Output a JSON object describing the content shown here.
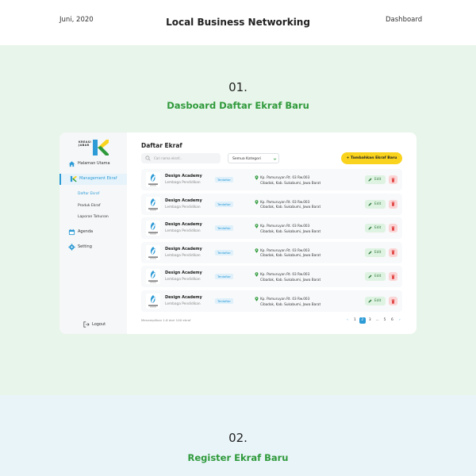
{
  "header": {
    "date": "Juni, 2020",
    "title": "Local Business Networking",
    "right_link": "Dashboard"
  },
  "section1": {
    "number": "01.",
    "title": "Dasboard Daftar Ekraf Baru"
  },
  "section2": {
    "number": "02.",
    "title": "Register Ekraf  Baru"
  },
  "colors": {
    "accent_blue": "#2d9bd6",
    "brand_green": "#2f9a3b",
    "button_yellow": "#f9d31e",
    "section1_bg": "#e8f5ea",
    "section2_bg": "#e9f4f9"
  },
  "logo": {
    "line1": "KREASI",
    "line2": "JABAR"
  },
  "sidebar": {
    "items": [
      {
        "label": "Halaman Utama",
        "icon": "home-icon"
      },
      {
        "label": "Management Ekraf",
        "icon": "k-logo-icon"
      },
      {
        "label": "Agenda",
        "icon": "calendar-icon"
      },
      {
        "label": "Setting",
        "icon": "gear-icon"
      }
    ],
    "subitems": [
      {
        "label": "Daftar Ekraf"
      },
      {
        "label": "Produk Ekraf"
      },
      {
        "label": "Laporan Tahunan"
      }
    ],
    "logout": "Logout"
  },
  "main": {
    "title": "Daftar Ekraf",
    "search_placeholder": "Cari nama ekraf...",
    "category_select": "Semua Kategori",
    "add_button": "+ Tambahkan Ekraf Baru",
    "rows": [
      {
        "name": "Design Academy",
        "type": "Lembaga Pendidikan",
        "status": "Terdaftar",
        "address1": "Kp. Pamuruyan Rt. 03 Rw.003",
        "address2": "Cibadak, Kab. Sukabumi, Jawa Barat",
        "edit": "Edit"
      },
      {
        "name": "Design Academy",
        "type": "Lembaga Pendidikan",
        "status": "Terdaftar",
        "address1": "Kp. Pamuruyan Rt. 03 Rw.003",
        "address2": "Cibadak, Kab. Sukabumi, Jawa Barat",
        "edit": "Edit"
      },
      {
        "name": "Design Academy",
        "type": "Lembaga Pendidikan",
        "status": "Terdaftar",
        "address1": "Kp. Pamuruyan Rt. 03 Rw.003",
        "address2": "Cibadak, Kab. Sukabumi, Jawa Barat",
        "edit": "Edit"
      },
      {
        "name": "Design Academy",
        "type": "Lembaga Pendidikan",
        "status": "Terdaftar",
        "address1": "Kp. Pamuruyan Rt. 03 Rw.003",
        "address2": "Cibadak, Kab. Sukabumi, Jawa Barat",
        "edit": "Edit"
      },
      {
        "name": "Design Academy",
        "type": "Lembaga Pendidikan",
        "status": "Terdaftar",
        "address1": "Kp. Pamuruyan Rt. 03 Rw.003",
        "address2": "Cibadak, Kab. Sukabumi, Jawa Barat",
        "edit": "Edit"
      },
      {
        "name": "Design Academy",
        "type": "Lembaga Pendidikan",
        "status": "Terdaftar",
        "address1": "Kp. Pamuruyan Rt. 03 Rw.003",
        "address2": "Cibadak, Kab. Sukabumi, Jawa Barat",
        "edit": "Edit"
      }
    ],
    "footer_text": "Menampilkan 1-6 dari 100 ekraf",
    "pagination": {
      "prev": "‹",
      "pages": [
        "1",
        "2",
        "3",
        "...",
        "5",
        "6"
      ],
      "current": "2",
      "next": "›"
    }
  }
}
